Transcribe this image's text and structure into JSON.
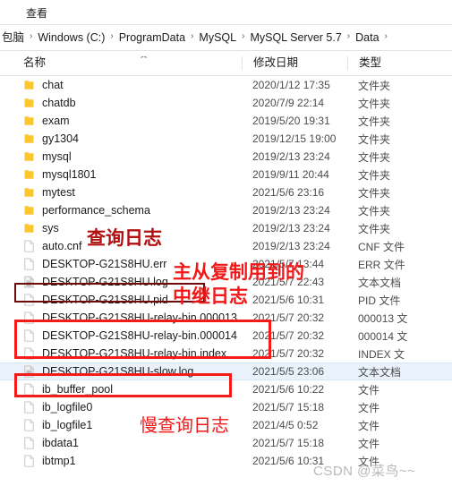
{
  "ribbon": {
    "tab_label": "查看"
  },
  "breadcrumb": {
    "items": [
      "包脑",
      "Windows (C:)",
      "ProgramData",
      "MySQL",
      "MySQL Server 5.7",
      "Data"
    ],
    "separator": "›"
  },
  "columns": {
    "name": "名称",
    "date": "修改日期",
    "type": "类型",
    "sort_caret": "⌃"
  },
  "files": [
    {
      "name": "chat",
      "date": "2020/1/12 17:35",
      "type": "文件夹",
      "icon": "folder-icon",
      "selected": false
    },
    {
      "name": "chatdb",
      "date": "2020/7/9 22:14",
      "type": "文件夹",
      "icon": "folder-icon",
      "selected": false
    },
    {
      "name": "exam",
      "date": "2019/5/20 19:31",
      "type": "文件夹",
      "icon": "folder-icon",
      "selected": false
    },
    {
      "name": "gy1304",
      "date": "2019/12/15 19:00",
      "type": "文件夹",
      "icon": "folder-icon",
      "selected": false
    },
    {
      "name": "mysql",
      "date": "2019/2/13 23:24",
      "type": "文件夹",
      "icon": "folder-icon",
      "selected": false
    },
    {
      "name": "mysql1801",
      "date": "2019/9/11 20:44",
      "type": "文件夹",
      "icon": "folder-icon",
      "selected": false
    },
    {
      "name": "mytest",
      "date": "2021/5/6 23:16",
      "type": "文件夹",
      "icon": "folder-icon",
      "selected": false
    },
    {
      "name": "performance_schema",
      "date": "2019/2/13 23:24",
      "type": "文件夹",
      "icon": "folder-icon",
      "selected": false
    },
    {
      "name": "sys",
      "date": "2019/2/13 23:24",
      "type": "文件夹",
      "icon": "folder-icon",
      "selected": false
    },
    {
      "name": "auto.cnf",
      "date": "2019/2/13 23:24",
      "type": "CNF 文件",
      "icon": "file-icon",
      "selected": false
    },
    {
      "name": "DESKTOP-G21S8HU.err",
      "date": "2021/5/7 13:44",
      "type": "ERR 文件",
      "icon": "file-icon",
      "selected": false
    },
    {
      "name": "DESKTOP-G21S8HU.log",
      "date": "2021/5/7 22:43",
      "type": "文本文档",
      "icon": "text-file-icon",
      "selected": false
    },
    {
      "name": "DESKTOP-G21S8HU.pid",
      "date": "2021/5/6 10:31",
      "type": "PID 文件",
      "icon": "file-icon",
      "selected": false
    },
    {
      "name": "DESKTOP-G21S8HU-relay-bin.000013",
      "date": "2021/5/7 20:32",
      "type": "000013 文",
      "icon": "file-icon",
      "selected": false
    },
    {
      "name": "DESKTOP-G21S8HU-relay-bin.000014",
      "date": "2021/5/7 20:32",
      "type": "000014 文",
      "icon": "file-icon",
      "selected": false
    },
    {
      "name": "DESKTOP-G21S8HU-relay-bin.index",
      "date": "2021/5/7 20:32",
      "type": "INDEX 文",
      "icon": "file-icon",
      "selected": false
    },
    {
      "name": "DESKTOP-G21S8HU-slow.log",
      "date": "2021/5/5 23:06",
      "type": "文本文档",
      "icon": "text-file-icon",
      "selected": true
    },
    {
      "name": "ib_buffer_pool",
      "date": "2021/5/6 10:22",
      "type": "文件",
      "icon": "file-icon",
      "selected": false
    },
    {
      "name": "ib_logfile0",
      "date": "2021/5/7 15:18",
      "type": "文件",
      "icon": "file-icon",
      "selected": false
    },
    {
      "name": "ib_logfile1",
      "date": "2021/4/5 0:52",
      "type": "文件",
      "icon": "file-icon",
      "selected": false
    },
    {
      "name": "ibdata1",
      "date": "2021/5/7 15:18",
      "type": "文件",
      "icon": "file-icon",
      "selected": false
    },
    {
      "name": "ibtmp1",
      "date": "2021/5/6 10:31",
      "type": "文件",
      "icon": "file-icon",
      "selected": false
    }
  ],
  "annotations": {
    "query_log": "查询日志",
    "replication_line1": "主从复制用到的",
    "replication_line2": "中继日志",
    "slow_query_log": "慢查询日志"
  },
  "watermark": {
    "text": "CSDN @菜鸟~~"
  },
  "colors": {
    "annotation_red": "#f01818",
    "annotation_dark_red": "#b01010",
    "box_bright_red": "#f51b1b",
    "box_dark_red": "#6d0b0b",
    "folder_yellow": "#fcc72e",
    "selection_blue": "#e9f2fb"
  }
}
